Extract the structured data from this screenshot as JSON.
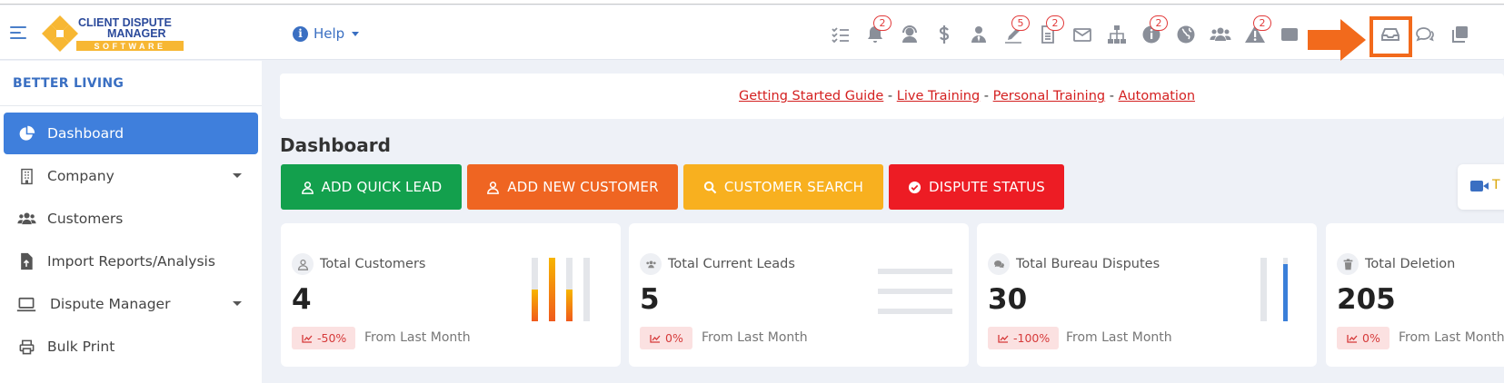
{
  "header": {
    "logo": {
      "line1": "CLIENT DISPUTE",
      "line2": "MANAGER",
      "line3": "SOFTWARE"
    },
    "help_label": "Help",
    "toolbar_icons": [
      {
        "name": "tasks-icon",
        "badge": ""
      },
      {
        "name": "bell-icon",
        "badge": "2"
      },
      {
        "name": "support-agent-icon",
        "badge": ""
      },
      {
        "name": "dollar-icon",
        "badge": ""
      },
      {
        "name": "user-tie-icon",
        "badge": ""
      },
      {
        "name": "signature-icon",
        "badge": "5"
      },
      {
        "name": "document-icon",
        "badge": "2"
      },
      {
        "name": "envelope-icon",
        "badge": ""
      },
      {
        "name": "sitemap-icon",
        "badge": ""
      },
      {
        "name": "info-circle-icon",
        "badge": "2"
      },
      {
        "name": "globe-icon",
        "badge": ""
      },
      {
        "name": "users-icon",
        "badge": ""
      },
      {
        "name": "warning-icon",
        "badge": "2"
      },
      {
        "name": "inbox-icon",
        "badge": ""
      },
      {
        "name": "chat-icon",
        "badge": ""
      },
      {
        "name": "copy-icon",
        "badge": ""
      }
    ],
    "accent_color": "#3a6fc2",
    "highlight_color": "#f26a1c"
  },
  "sidebar": {
    "org_name": "BETTER LIVING",
    "items": [
      {
        "label": "Dashboard",
        "icon": "pie-chart-icon",
        "active": true,
        "has_caret": false
      },
      {
        "label": "Company",
        "icon": "building-icon",
        "active": false,
        "has_caret": true
      },
      {
        "label": "Customers",
        "icon": "users-icon",
        "active": false,
        "has_caret": false
      },
      {
        "label": "Import Reports/Analysis",
        "icon": "file-import-icon",
        "active": false,
        "has_caret": false
      },
      {
        "label": "Dispute Manager",
        "icon": "laptop-icon",
        "active": false,
        "has_caret": true
      },
      {
        "label": "Bulk Print",
        "icon": "printer-icon",
        "active": false,
        "has_caret": false
      }
    ]
  },
  "banner": {
    "links": [
      "Getting Started Guide",
      "Live Training",
      "Personal Training",
      "Automation"
    ],
    "separator": " - "
  },
  "page_title": "Dashboard",
  "actions": [
    {
      "label": "ADD QUICK LEAD",
      "icon": "user-outline-icon",
      "color": "#13a04d"
    },
    {
      "label": "ADD NEW CUSTOMER",
      "icon": "user-outline-icon",
      "color": "#ef6522"
    },
    {
      "label": "CUSTOMER SEARCH",
      "icon": "search-icon",
      "color": "#f8b01f"
    },
    {
      "label": "DISPUTE STATUS",
      "icon": "check-circle-icon",
      "color": "#ed1c24"
    }
  ],
  "side_tab": {
    "label": "T"
  },
  "cards": [
    {
      "title": "Total Customers",
      "value": "4",
      "change": "-50%",
      "since": "From Last Month",
      "icon": "user-outline-icon"
    },
    {
      "title": "Total Current Leads",
      "value": "5",
      "change": "0%",
      "since": "From Last Month",
      "icon": "users-icon"
    },
    {
      "title": "Total Bureau Disputes",
      "value": "30",
      "change": "-100%",
      "since": "From Last Month",
      "icon": "chat-bubbles-icon"
    },
    {
      "title": "Total Deletion",
      "value": "205",
      "change": "0%",
      "since": "From Last Month",
      "icon": "trash-icon"
    }
  ],
  "card_sparks": {
    "customers_bars": [
      0,
      0.5,
      1.0,
      0.5,
      0
    ],
    "disputes_bars": [
      0,
      0.9
    ]
  }
}
